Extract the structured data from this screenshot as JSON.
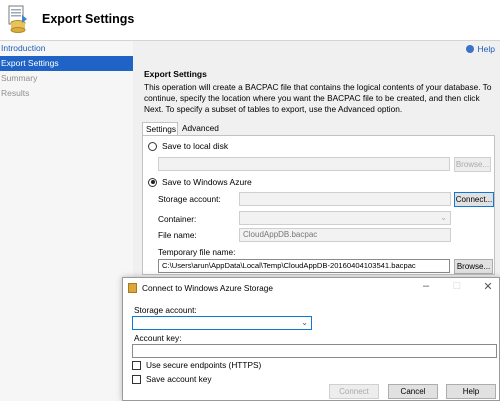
{
  "header": {
    "title": "Export Settings"
  },
  "nav": {
    "items": [
      {
        "label": "Introduction",
        "state": "link"
      },
      {
        "label": "Export Settings",
        "state": "active"
      },
      {
        "label": "Summary",
        "state": "disabled"
      },
      {
        "label": "Results",
        "state": "disabled"
      }
    ]
  },
  "main": {
    "help_label": "Help",
    "section_title": "Export Settings",
    "description": "This operation will create a BACPAC file that contains the logical contents of your database. To continue, specify the location where you want the BACPAC file to be created, and then click Next. To specify a subset of tables to export, use the Advanced option.",
    "tabs": [
      {
        "label": "Settings"
      },
      {
        "label": "Advanced"
      }
    ],
    "local": {
      "radio_label": "Save to local disk",
      "path_value": "",
      "browse_label": "Browse..."
    },
    "azure": {
      "radio_label": "Save to Windows Azure",
      "storage_account_label": "Storage account:",
      "storage_account_value": "",
      "connect_label": "Connect...",
      "container_label": "Container:",
      "container_value": "",
      "file_name_label": "File name:",
      "file_name_value": "CloudAppDB.bacpac",
      "temp_file_label": "Temporary file name:",
      "temp_file_value": "C:\\Users\\arun\\AppData\\Local\\Temp\\CloudAppDB-20160404103541.bacpac",
      "temp_browse_label": "Browse..."
    }
  },
  "dialog": {
    "title": "Connect to Windows Azure Storage",
    "storage_account_label": "Storage account:",
    "storage_account_value": "",
    "account_key_label": "Account key:",
    "account_key_value": "",
    "use_https_label": "Use secure endpoints (HTTPS)",
    "save_key_label": "Save account key",
    "connect_label": "Connect",
    "cancel_label": "Cancel",
    "help_label": "Help"
  },
  "colors": {
    "accent": "#1f63c6",
    "link": "#1c5fb5",
    "nav_background": "#f6f6f6",
    "content_background": "#f0f0f0"
  },
  "icons": [
    "export-wizard-icon",
    "help-icon",
    "dropdown-arrow-icon",
    "storage-icon",
    "minimize-icon",
    "maximize-icon",
    "close-icon"
  ]
}
